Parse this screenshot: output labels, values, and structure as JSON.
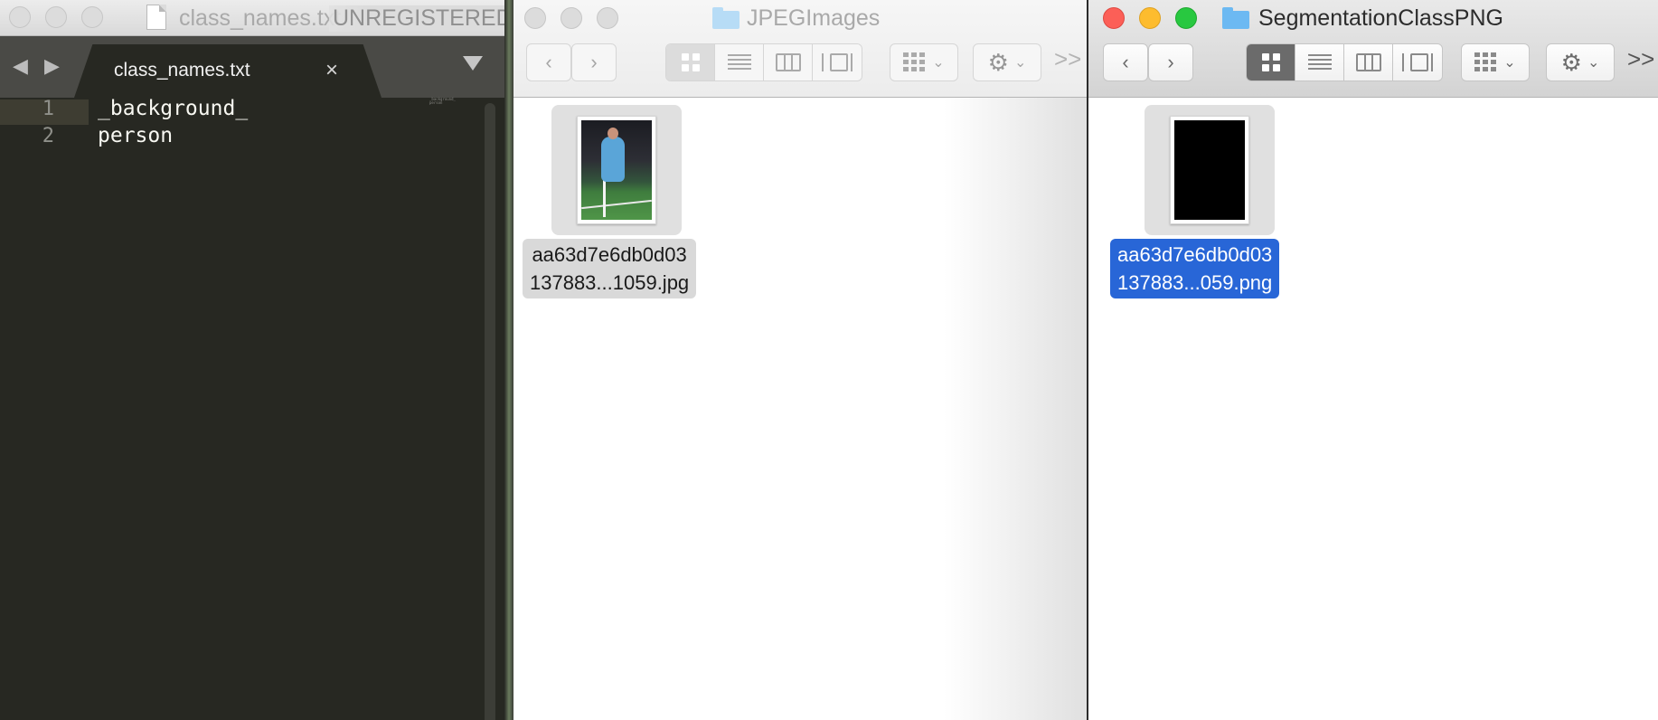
{
  "editor": {
    "title": "class_names.txt",
    "unregistered": "UNREGISTERED",
    "tab_label": "class_names.txt",
    "tab_close": "×",
    "nav_arrows": "◀ ▶",
    "lines": [
      {
        "num": "1",
        "text": "_background_"
      },
      {
        "num": "2",
        "text": "person"
      }
    ],
    "minimap": "_background_\nperson"
  },
  "finder_jpeg": {
    "title": "JPEGImages",
    "back": "‹",
    "forward": "›",
    "more": ">>",
    "file": {
      "line1": "aa63d7e6db0d03",
      "line2": "137883...1059.jpg"
    }
  },
  "finder_seg": {
    "title": "SegmentationClassPNG",
    "back": "‹",
    "forward": "›",
    "more": ">>",
    "file": {
      "line1": "aa63d7e6db0d03",
      "line2": "137883...059.png"
    }
  },
  "colors": {
    "editor_bg": "#272822",
    "selection_blue": "#2866d7",
    "folder_blue": "#6cb9f2"
  },
  "icons": [
    "document-icon",
    "folder-icon",
    "icon-view-icon",
    "list-view-icon",
    "column-view-icon",
    "cover-flow-icon",
    "arrange-icon",
    "gear-icon"
  ]
}
